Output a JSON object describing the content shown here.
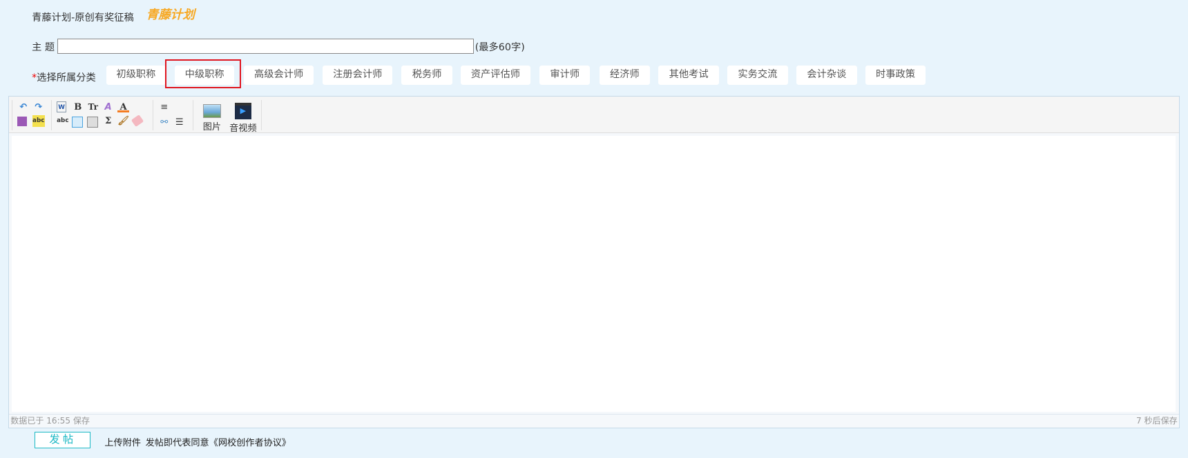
{
  "header": {
    "title": "青藤计划-原创有奖征稿",
    "logo_text": "青藤计划"
  },
  "subject": {
    "label": "主 题",
    "value": "",
    "hint": "(最多60字)"
  },
  "category": {
    "required_mark": "*",
    "label": "选择所属分类",
    "selected": "中级职称",
    "items": [
      "初级职称",
      "中级职称",
      "高级会计师",
      "注册会计师",
      "税务师",
      "资产评估师",
      "审计师",
      "经济师",
      "其他考试",
      "实务交流",
      "会计杂谈",
      "时事政策"
    ]
  },
  "toolbar": {
    "image_label": "图片",
    "video_label": "音视频",
    "bold": "B",
    "font_size": "Tr",
    "format": "A",
    "font_color": "A",
    "formula": "Σ"
  },
  "status": {
    "saved": "数据已于 16:55 保存",
    "countdown": "7 秒后保存"
  },
  "footer": {
    "post_label": "发帖",
    "upload_label": "上传附件",
    "agreement": "发帖即代表同意《网校创作者协议》"
  },
  "colors": {
    "accent": "#1ab8c4",
    "selected_border": "#e0141e",
    "logo": "#f7a823"
  }
}
